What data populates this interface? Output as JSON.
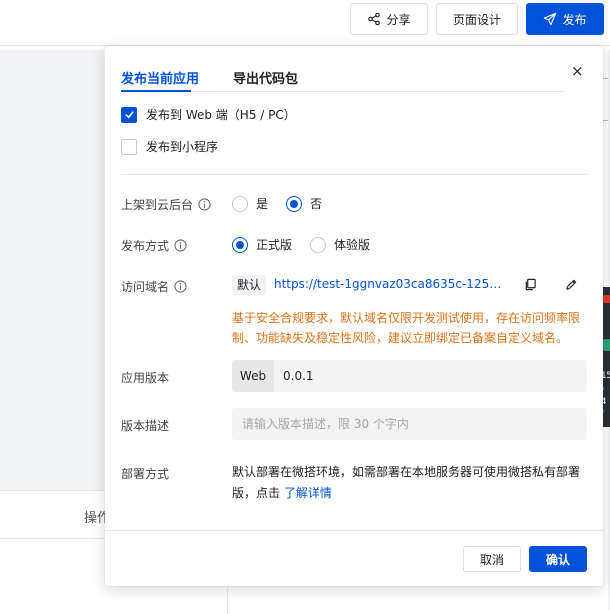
{
  "topbar": {
    "share_label": "分享",
    "page_design_label": "页面设计",
    "publish_label": "发布"
  },
  "background": {
    "operation_label": "操作",
    "widget_num_1": "15",
    "widget_num_2": "4"
  },
  "dialog": {
    "tabs": [
      {
        "label": "发布当前应用",
        "active": true
      },
      {
        "label": "导出代码包",
        "active": false
      }
    ],
    "close_symbol": "×",
    "targets": [
      {
        "label": "发布到 Web 端（H5 / PC）",
        "checked": true
      },
      {
        "label": "发布到小程序",
        "checked": false
      }
    ],
    "cloud_console": {
      "label": "上架到云后台",
      "options": [
        {
          "label": "是",
          "selected": false
        },
        {
          "label": "否",
          "selected": true
        }
      ]
    },
    "publish_mode": {
      "label": "发布方式",
      "options": [
        {
          "label": "正式版",
          "selected": true
        },
        {
          "label": "体验版",
          "selected": false
        }
      ]
    },
    "domain": {
      "label": "访问域名",
      "tag": "默认",
      "url": "https://test-1ggnvaz03ca8635c-1255909...",
      "warning": "基于安全合规要求，默认域名仅限开发测试使用，存在访问频率限制、功能缺失及稳定性风险，建议立即绑定已备案自定义域名。"
    },
    "version": {
      "label": "应用版本",
      "prefix": "Web",
      "value": "0.0.1"
    },
    "description": {
      "label": "版本描述",
      "placeholder": "请输入版本描述，限 30 个字内"
    },
    "deploy": {
      "label": "部署方式",
      "text": "默认部署在微搭环境，如需部署在本地服务器可使用微搭私有部署版，点击 ",
      "link": "了解详情"
    },
    "footer": {
      "cancel_label": "取消",
      "confirm_label": "确认"
    }
  },
  "colors": {
    "primary": "#0052d9",
    "warning": "#e37318",
    "border": "#e6e8eb"
  }
}
